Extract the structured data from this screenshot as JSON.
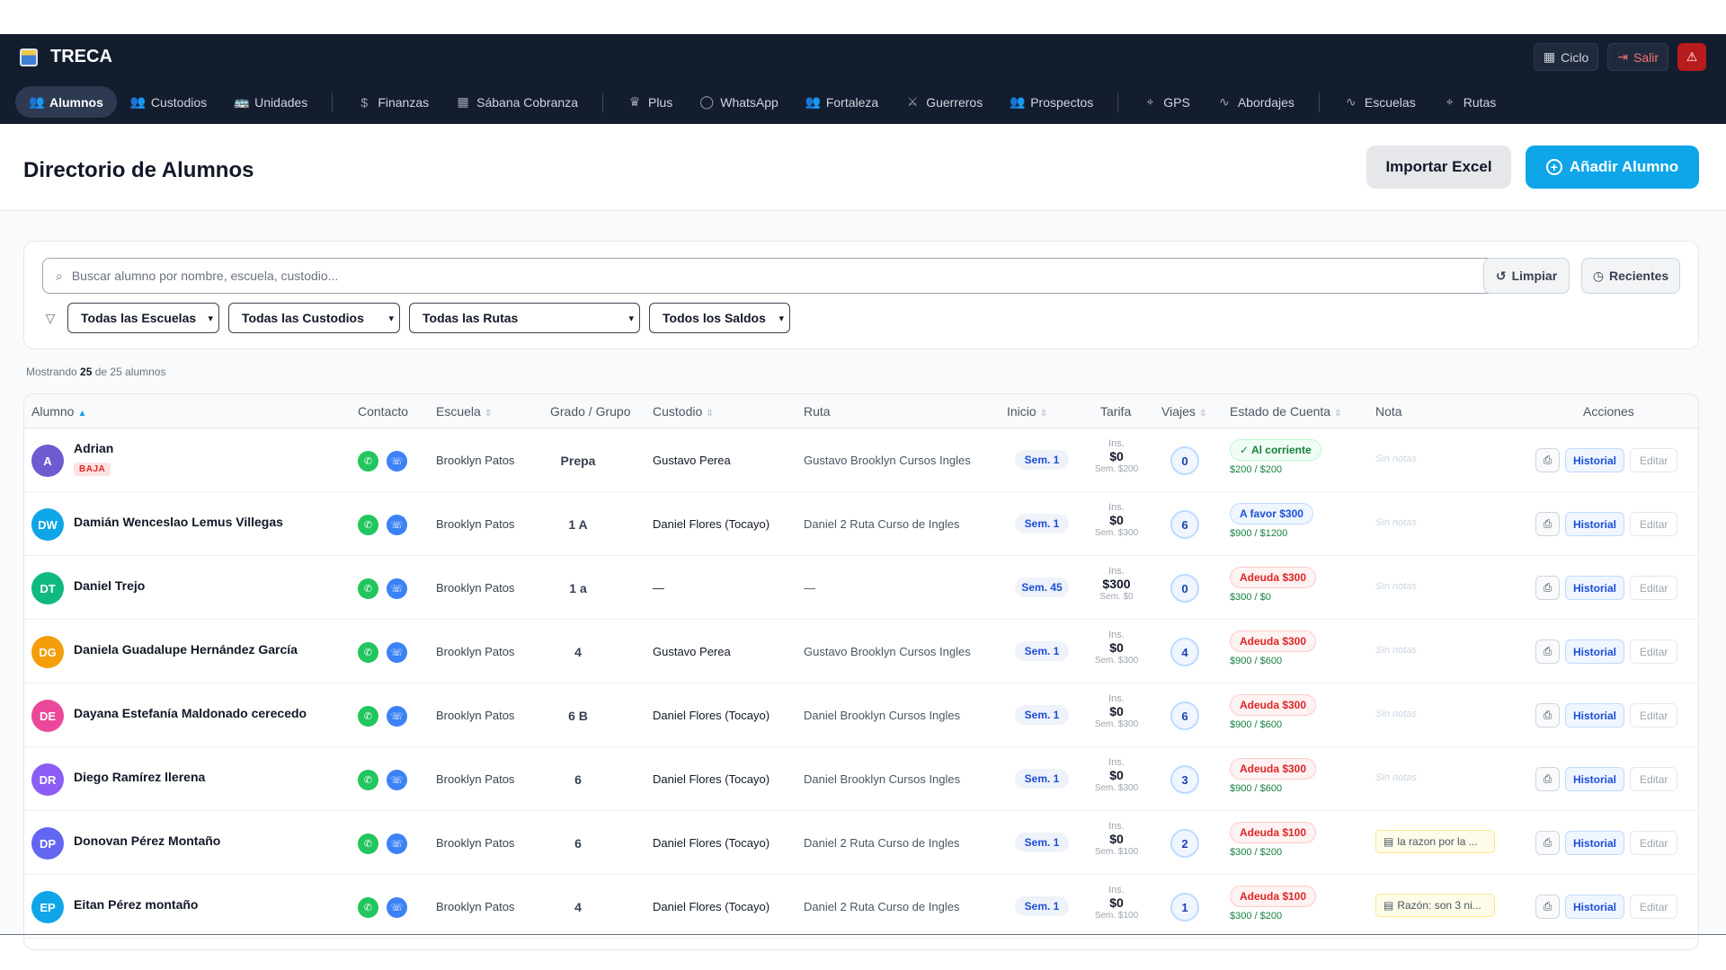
{
  "app": {
    "title": "TRECA"
  },
  "top_actions": {
    "ciclo": "Ciclo",
    "salir": "Salir"
  },
  "nav": [
    {
      "label": "Alumnos",
      "icon": "users-icon",
      "glyph": "👥",
      "active": true
    },
    {
      "label": "Custodios",
      "icon": "users-icon",
      "glyph": "👥"
    },
    {
      "label": "Unidades",
      "icon": "bus-icon",
      "glyph": "🚌"
    },
    {
      "sep": true
    },
    {
      "label": "Finanzas",
      "icon": "dollar-icon",
      "glyph": "$"
    },
    {
      "label": "Sábana Cobranza",
      "icon": "calendar-icon",
      "glyph": "▦"
    },
    {
      "sep": true
    },
    {
      "label": "Plus",
      "icon": "crown-icon",
      "glyph": "♛"
    },
    {
      "label": "WhatsApp",
      "icon": "chat-icon",
      "glyph": "◯"
    },
    {
      "label": "Fortaleza",
      "icon": "users-icon",
      "glyph": "👥"
    },
    {
      "label": "Guerreros",
      "icon": "swords-icon",
      "glyph": "⚔"
    },
    {
      "label": "Prospectos",
      "icon": "users-icon",
      "glyph": "👥"
    },
    {
      "sep": true
    },
    {
      "label": "GPS",
      "icon": "map-pin-icon",
      "glyph": "⌖"
    },
    {
      "label": "Abordajes",
      "icon": "activity-icon",
      "glyph": "∿"
    },
    {
      "sep": true
    },
    {
      "label": "Escuelas",
      "icon": "activity-icon",
      "glyph": "∿"
    },
    {
      "label": "Rutas",
      "icon": "map-pin-icon",
      "glyph": "⌖"
    }
  ],
  "header": {
    "title": "Directorio de Alumnos",
    "import_label": "Importar Excel",
    "add_label": "Añadir Alumno"
  },
  "search": {
    "placeholder": "Buscar alumno por nombre, escuela, custodio...",
    "clear_label": "Limpiar",
    "recent_label": "Recientes"
  },
  "filters": {
    "escuelas": "Todas las Escuelas",
    "custodios": "Todas las Custodios",
    "rutas": "Todas las Rutas",
    "saldos": "Todos los Saldos"
  },
  "showing": {
    "prefix": "Mostrando",
    "count": "25",
    "suffix": "de 25 alumnos"
  },
  "columns": {
    "alumno": "Alumno",
    "contacto": "Contacto",
    "escuela": "Escuela",
    "grado": "Grado / Grupo",
    "custodio": "Custodio",
    "ruta": "Ruta",
    "inicio": "Inicio",
    "tarifa": "Tarifa",
    "viajes": "Viajes",
    "estado": "Estado de Cuenta",
    "nota": "Nota",
    "acciones": "Acciones"
  },
  "labels": {
    "historial": "Historial",
    "editar": "Editar",
    "ins": "Ins.",
    "sin_notas": "Sin notas",
    "baja": "BAJA"
  },
  "colors": {
    "accent": "#0ea5e9",
    "nav_bg": "#141d2e"
  },
  "rows": [
    {
      "initials": "A",
      "color": "#6d5bd0",
      "name": "Adrian",
      "baja": true,
      "school": "Brooklyn Patos",
      "grade": "Prepa",
      "custodio": "Gustavo Perea",
      "ruta": "Gustavo Brooklyn Cursos Ingles",
      "inicio": "Sem. 1",
      "ins": "$0",
      "sem": "Sem. $200",
      "viajes": "0",
      "status": "✓ Al corriente",
      "status_type": "green",
      "balance": "$200 / $200",
      "nota": ""
    },
    {
      "initials": "DW",
      "color": "#0ea5e9",
      "name": "Damián Wenceslao Lemus Villegas",
      "baja": false,
      "school": "Brooklyn Patos",
      "grade": "1 A",
      "custodio": "Daniel Flores (Tocayo)",
      "ruta": "Daniel 2 Ruta Curso de Ingles",
      "inicio": "Sem. 1",
      "ins": "$0",
      "sem": "Sem. $300",
      "viajes": "6",
      "status": "A favor $300",
      "status_type": "blue",
      "balance": "$900 / $1200",
      "nota": ""
    },
    {
      "initials": "DT",
      "color": "#10b981",
      "name": "Daniel Trejo",
      "baja": false,
      "school": "Brooklyn Patos",
      "grade": "1 a",
      "custodio": "—",
      "ruta": "—",
      "inicio": "Sem. 45",
      "ins": "$300",
      "sem": "Sem. $0",
      "viajes": "0",
      "status": "Adeuda $300",
      "status_type": "red",
      "balance": "$300 / $0",
      "nota": ""
    },
    {
      "initials": "DG",
      "color": "#f59e0b",
      "name": "Daniela Guadalupe Hernández García",
      "baja": false,
      "school": "Brooklyn Patos",
      "grade": "4",
      "custodio": "Gustavo Perea",
      "ruta": "Gustavo Brooklyn Cursos Ingles",
      "inicio": "Sem. 1",
      "ins": "$0",
      "sem": "Sem. $300",
      "viajes": "4",
      "status": "Adeuda $300",
      "status_type": "red",
      "balance": "$900 / $600",
      "nota": ""
    },
    {
      "initials": "DE",
      "color": "#ec4899",
      "name": "Dayana Estefanía Maldonado cerecedo",
      "baja": false,
      "school": "Brooklyn Patos",
      "grade": "6 B",
      "custodio": "Daniel Flores (Tocayo)",
      "ruta": "Daniel Brooklyn Cursos Ingles",
      "inicio": "Sem. 1",
      "ins": "$0",
      "sem": "Sem. $300",
      "viajes": "6",
      "status": "Adeuda $300",
      "status_type": "red",
      "balance": "$900 / $600",
      "nota": ""
    },
    {
      "initials": "DR",
      "color": "#8b5cf6",
      "name": "Diego Ramírez llerena",
      "baja": false,
      "school": "Brooklyn Patos",
      "grade": "6",
      "custodio": "Daniel Flores (Tocayo)",
      "ruta": "Daniel Brooklyn Cursos Ingles",
      "inicio": "Sem. 1",
      "ins": "$0",
      "sem": "Sem. $300",
      "viajes": "3",
      "status": "Adeuda $300",
      "status_type": "red",
      "balance": "$900 / $600",
      "nota": ""
    },
    {
      "initials": "DP",
      "color": "#6366f1",
      "name": "Donovan Pérez Montaño",
      "baja": false,
      "school": "Brooklyn Patos",
      "grade": "6",
      "custodio": "Daniel Flores (Tocayo)",
      "ruta": "Daniel 2 Ruta Curso de Ingles",
      "inicio": "Sem. 1",
      "ins": "$0",
      "sem": "Sem. $100",
      "viajes": "2",
      "status": "Adeuda $100",
      "status_type": "red",
      "balance": "$300 / $200",
      "nota": "la razon por la ..."
    },
    {
      "initials": "EP",
      "color": "#0ea5e9",
      "name": "Eitan Pérez montaño",
      "baja": false,
      "school": "Brooklyn Patos",
      "grade": "4",
      "custodio": "Daniel Flores (Tocayo)",
      "ruta": "Daniel 2 Ruta Curso de Ingles",
      "inicio": "Sem. 1",
      "ins": "$0",
      "sem": "Sem. $100",
      "viajes": "1",
      "status": "Adeuda $100",
      "status_type": "red",
      "balance": "$300 / $200",
      "nota": "Razón: son 3 ni..."
    }
  ]
}
